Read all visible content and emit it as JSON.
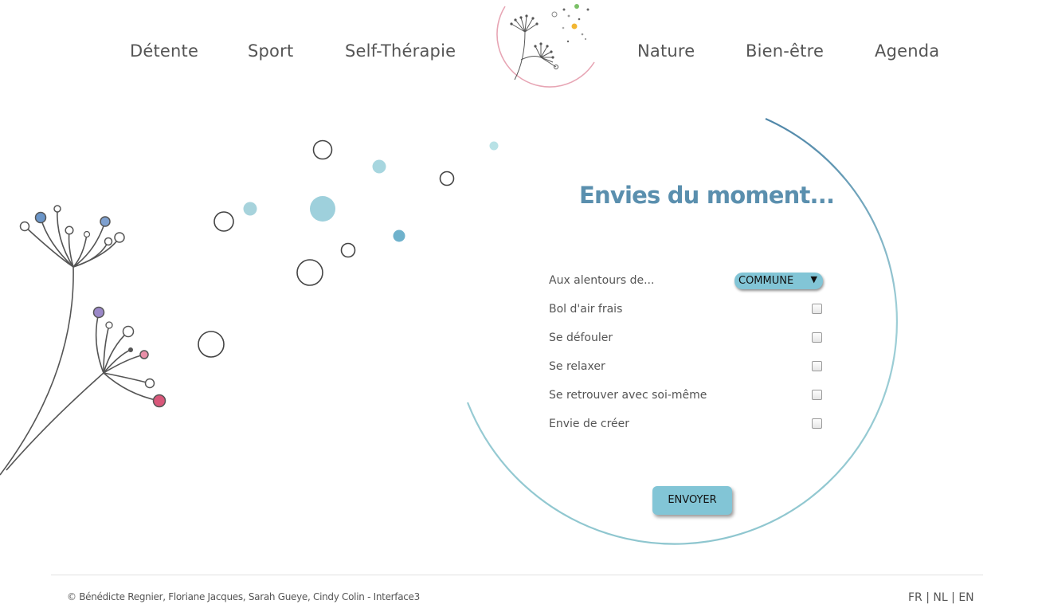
{
  "nav": {
    "items": [
      "Détente",
      "Sport",
      "Self-Thérapie",
      "Nature",
      "Bien-être",
      "Agenda"
    ]
  },
  "form": {
    "title": "Envies du moment...",
    "location_label": "Aux alentours de...",
    "location_select_value": "COMMUNE",
    "options": [
      {
        "label": "Bol d'air frais",
        "checked": false
      },
      {
        "label": "Se défouler",
        "checked": false
      },
      {
        "label": "Se relaxer",
        "checked": false
      },
      {
        "label": "Se retrouver avec soi-même",
        "checked": false
      },
      {
        "label": "Envie de créer",
        "checked": false
      }
    ],
    "submit_label": "ENVOYER"
  },
  "footer": {
    "copyright": "© Bénédicte Regnier, Floriane Jacques, Sarah Gueye, Cindy Colin - Interface3",
    "languages": [
      "FR",
      "NL",
      "EN"
    ]
  },
  "colors": {
    "accent": "#82c5d6",
    "title": "#5a8fae",
    "arc_dark": "#4f86a8",
    "arc_light": "#bfe2e6",
    "logo_ring": "#e7a5b4"
  },
  "icons": {
    "logo": "dandelion-logo-icon",
    "decoration": "dandelion-illustration-icon",
    "select_arrow": "caret-down-icon"
  }
}
